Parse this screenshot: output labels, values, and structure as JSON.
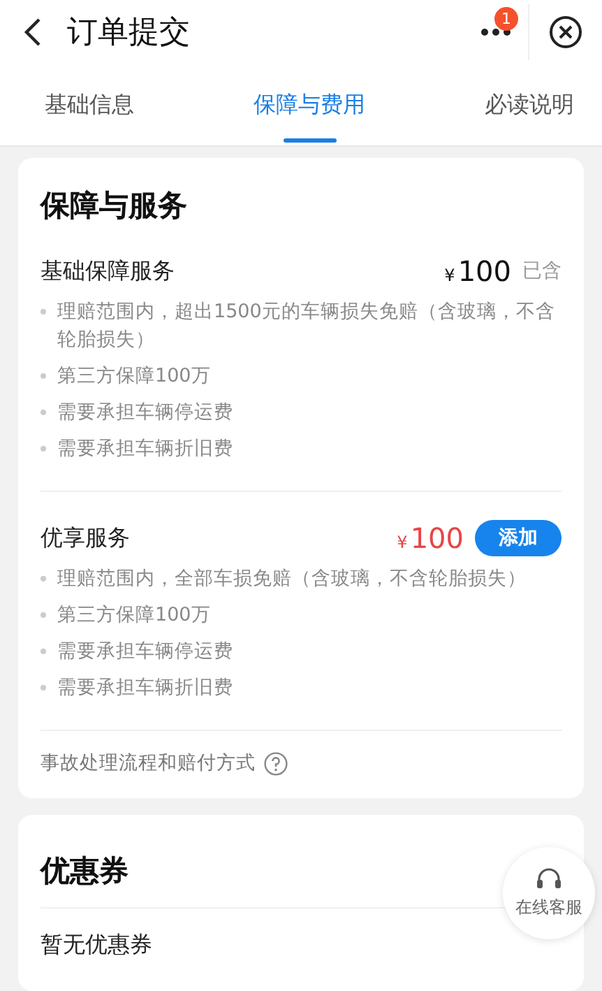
{
  "header": {
    "title": "订单提交",
    "badge": "1"
  },
  "tabs": [
    {
      "label": "基础信息",
      "selected": false
    },
    {
      "label": "保障与费用",
      "selected": true
    },
    {
      "label": "必读说明",
      "selected": false
    }
  ],
  "protection": {
    "title": "保障与服务",
    "plans": [
      {
        "kind": "included",
        "name": "基础保障服务",
        "currency": "¥",
        "price": "100",
        "status": "已含",
        "items": [
          "理赔范围内，超出1500元的车辆损失免赔（含玻璃，不含轮胎损失）",
          "第三方保障100万",
          "需要承担车辆停运费",
          "需要承担车辆折旧费"
        ]
      },
      {
        "kind": "optional",
        "name": "优享服务",
        "currency": "¥",
        "price": "100",
        "action": "添加",
        "items": [
          "理赔范围内，全部车损免赔（含玻璃，不含轮胎损失）",
          "第三方保障100万",
          "需要承担车辆停运费",
          "需要承担车辆折旧费"
        ]
      }
    ],
    "link": "事故处理流程和赔付方式"
  },
  "coupons": {
    "title": "优惠券",
    "empty": "暂无优惠券"
  },
  "support": {
    "label": "在线客服"
  }
}
